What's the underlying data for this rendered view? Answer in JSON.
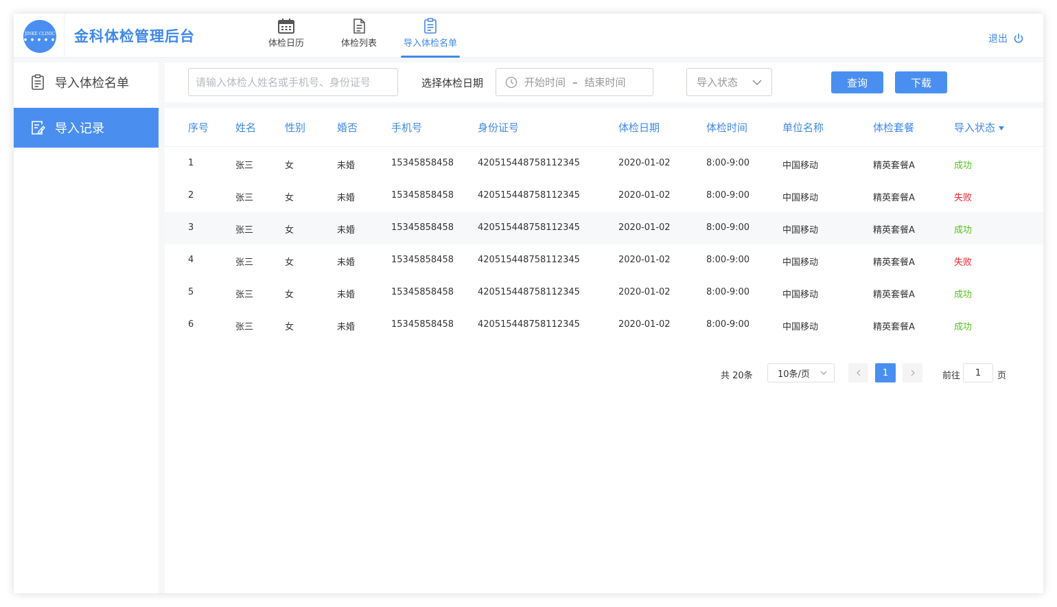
{
  "header": {
    "logo_text": "JINKE CLINIC",
    "logo_dots": "● ● ● ● ●",
    "title": "金科体检管理后台",
    "tabs": [
      {
        "label": "体检日历",
        "icon": "calendar-icon"
      },
      {
        "label": "体检列表",
        "icon": "document-list-icon"
      },
      {
        "label": "导入体检名单",
        "icon": "clipboard-icon",
        "active": true
      }
    ],
    "logout_label": "退出",
    "logout_icon": "power-icon"
  },
  "sidebar": {
    "items": [
      {
        "label": "导入体检名单",
        "icon": "clipboard-icon"
      },
      {
        "label": "导入记录",
        "icon": "edit-record-icon",
        "active": true
      }
    ]
  },
  "filters": {
    "search_placeholder": "请输入体检人姓名或手机号、身份证号",
    "date_label": "选择体检日期",
    "date_start_placeholder": "开始时间",
    "date_separator": "–",
    "date_end_placeholder": "结束时间",
    "status_placeholder": "导入状态",
    "query_label": "查询",
    "download_label": "下载"
  },
  "table": {
    "columns": [
      "序号",
      "姓名",
      "性别",
      "婚否",
      "手机号",
      "身份证号",
      "体检日期",
      "体检时间",
      "单位名称",
      "体检套餐",
      "导入状态"
    ],
    "rows": [
      {
        "no": "1",
        "name": "张三",
        "gender": "女",
        "married": "未婚",
        "phone": "15345858458",
        "id": "420515448758112345",
        "date": "2020-01-02",
        "time": "8:00-9:00",
        "unit": "中国移动",
        "package": "精英套餐A",
        "status": "成功",
        "ok": true
      },
      {
        "no": "2",
        "name": "张三",
        "gender": "女",
        "married": "未婚",
        "phone": "15345858458",
        "id": "420515448758112345",
        "date": "2020-01-02",
        "time": "8:00-9:00",
        "unit": "中国移动",
        "package": "精英套餐A",
        "status": "失败",
        "ok": false
      },
      {
        "no": "3",
        "name": "张三",
        "gender": "女",
        "married": "未婚",
        "phone": "15345858458",
        "id": "420515448758112345",
        "date": "2020-01-02",
        "time": "8:00-9:00",
        "unit": "中国移动",
        "package": "精英套餐A",
        "status": "成功",
        "ok": true
      },
      {
        "no": "4",
        "name": "张三",
        "gender": "女",
        "married": "未婚",
        "phone": "15345858458",
        "id": "420515448758112345",
        "date": "2020-01-02",
        "time": "8:00-9:00",
        "unit": "中国移动",
        "package": "精英套餐A",
        "status": "失败",
        "ok": false
      },
      {
        "no": "5",
        "name": "张三",
        "gender": "女",
        "married": "未婚",
        "phone": "15345858458",
        "id": "420515448758112345",
        "date": "2020-01-02",
        "time": "8:00-9:00",
        "unit": "中国移动",
        "package": "精英套餐A",
        "status": "成功",
        "ok": true
      },
      {
        "no": "6",
        "name": "张三",
        "gender": "女",
        "married": "未婚",
        "phone": "15345858458",
        "id": "420515448758112345",
        "date": "2020-01-02",
        "time": "8:00-9:00",
        "unit": "中国移动",
        "package": "精英套餐A",
        "status": "成功",
        "ok": true
      }
    ]
  },
  "pagination": {
    "total": "共 20条",
    "page_size": "10条/页",
    "current_page": "1",
    "goto_label": "前往",
    "goto_value": "1",
    "page_suffix": "页"
  },
  "colors": {
    "accent": "#4a8ff0",
    "success": "#52c41a",
    "fail": "#f5222d"
  }
}
